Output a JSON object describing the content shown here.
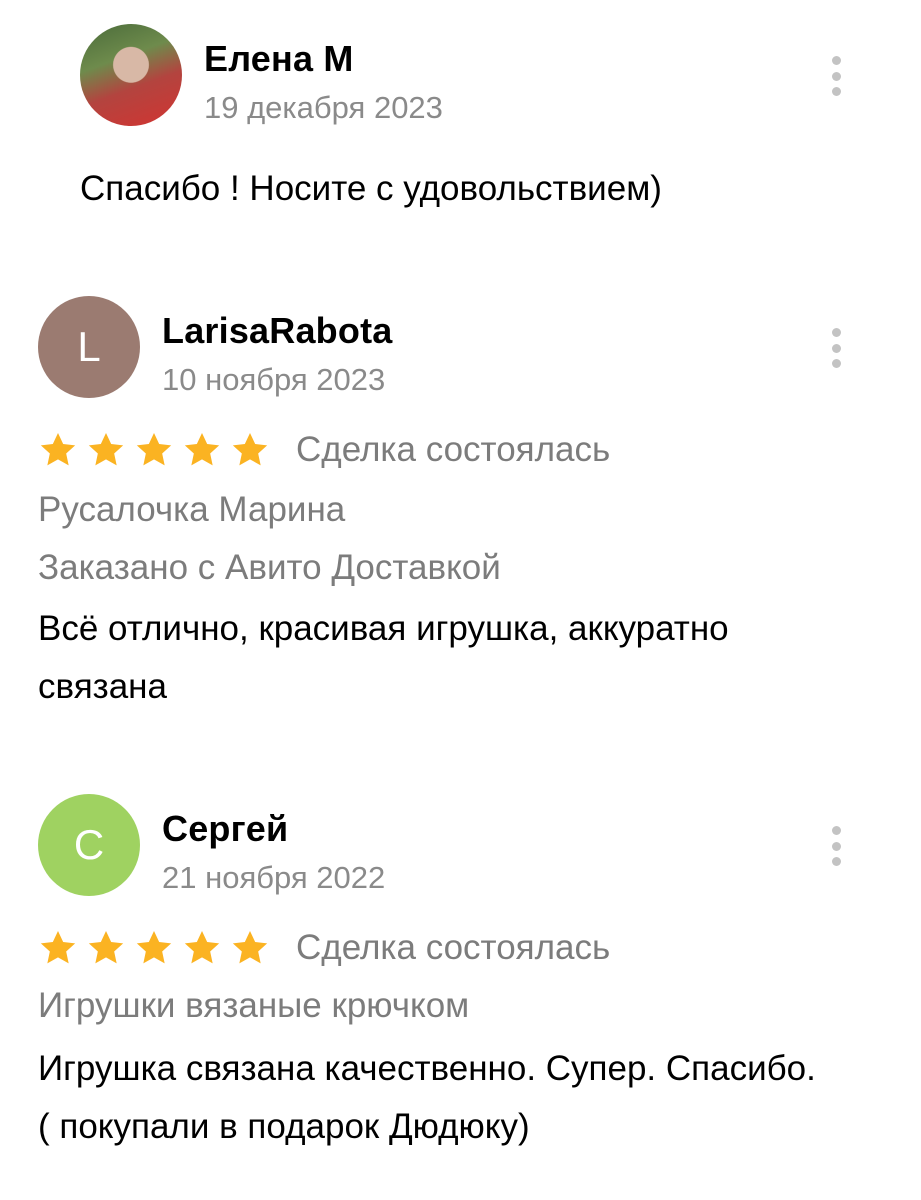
{
  "reviews": [
    {
      "author": "Елена М",
      "date": "19 декабря 2023",
      "avatar_type": "photo",
      "text": "Спасибо ! Носите с удовольствием)"
    },
    {
      "author": "LarisaRabota",
      "date": "10 ноября 2023",
      "avatar_letter": "L",
      "avatar_color": "#9b7b71",
      "rating": 5,
      "deal_status": "Сделка состоялась",
      "item": "Русалочка Марина",
      "delivery": "Заказано с Авито Доставкой",
      "text": "Всё отлично, красивая игрушка, аккуратно связана"
    },
    {
      "author": "Сергей",
      "date": "21 ноября 2022",
      "avatar_letter": "С",
      "avatar_color": "#9fd261",
      "rating": 5,
      "deal_status": "Сделка состоялась",
      "item": "Игрушки вязаные крючком",
      "text": "Игрушка связана качественно. Супер. Спасибо. ( покупали в подарок Дюдюку)"
    }
  ],
  "icons": {
    "menu": "more-vertical-icon",
    "star": "star-icon"
  },
  "colors": {
    "star": "#fbb322",
    "secondary_text": "#7c7c7c",
    "kebab": "#c3c3c3"
  }
}
